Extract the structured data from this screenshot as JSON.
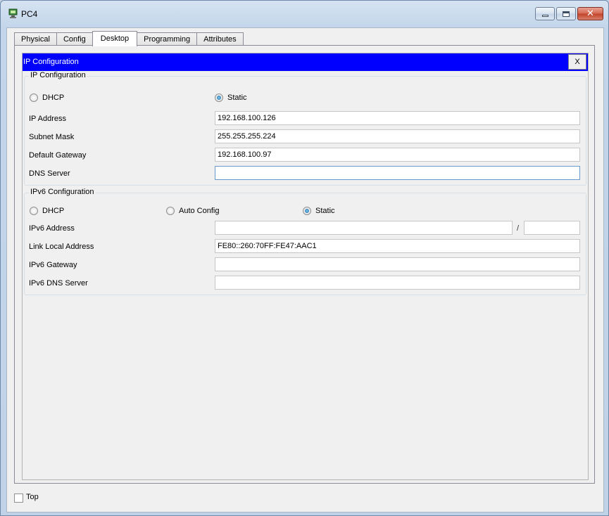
{
  "window": {
    "title": "PC4",
    "close_glyph": "✕"
  },
  "tabs": [
    {
      "label": "Physical"
    },
    {
      "label": "Config"
    },
    {
      "label": "Desktop"
    },
    {
      "label": "Programming"
    },
    {
      "label": "Attributes"
    }
  ],
  "panel": {
    "title": "IP Configuration",
    "close_label": "X"
  },
  "ipv4": {
    "group_title": "IP Configuration",
    "dhcp_label": "DHCP",
    "static_label": "Static",
    "selected_mode": "Static",
    "ip_address_label": "IP Address",
    "ip_address": "192.168.100.126",
    "subnet_mask_label": "Subnet Mask",
    "subnet_mask": "255.255.255.224",
    "default_gateway_label": "Default Gateway",
    "default_gateway": "192.168.100.97",
    "dns_server_label": "DNS Server",
    "dns_server": ""
  },
  "ipv6": {
    "group_title": "IPv6 Configuration",
    "dhcp_label": "DHCP",
    "auto_config_label": "Auto Config",
    "static_label": "Static",
    "selected_mode": "Static",
    "ipv6_address_label": "IPv6 Address",
    "ipv6_address": "",
    "prefix_separator": "/",
    "prefix_length": "",
    "link_local_label": "Link Local Address",
    "link_local": "FE80::260:70FF:FE47:AAC1",
    "gateway_label": "IPv6 Gateway",
    "gateway": "",
    "dns_label": "IPv6 DNS Server",
    "dns": ""
  },
  "footer": {
    "top_label": "Top",
    "top_checked": false
  }
}
